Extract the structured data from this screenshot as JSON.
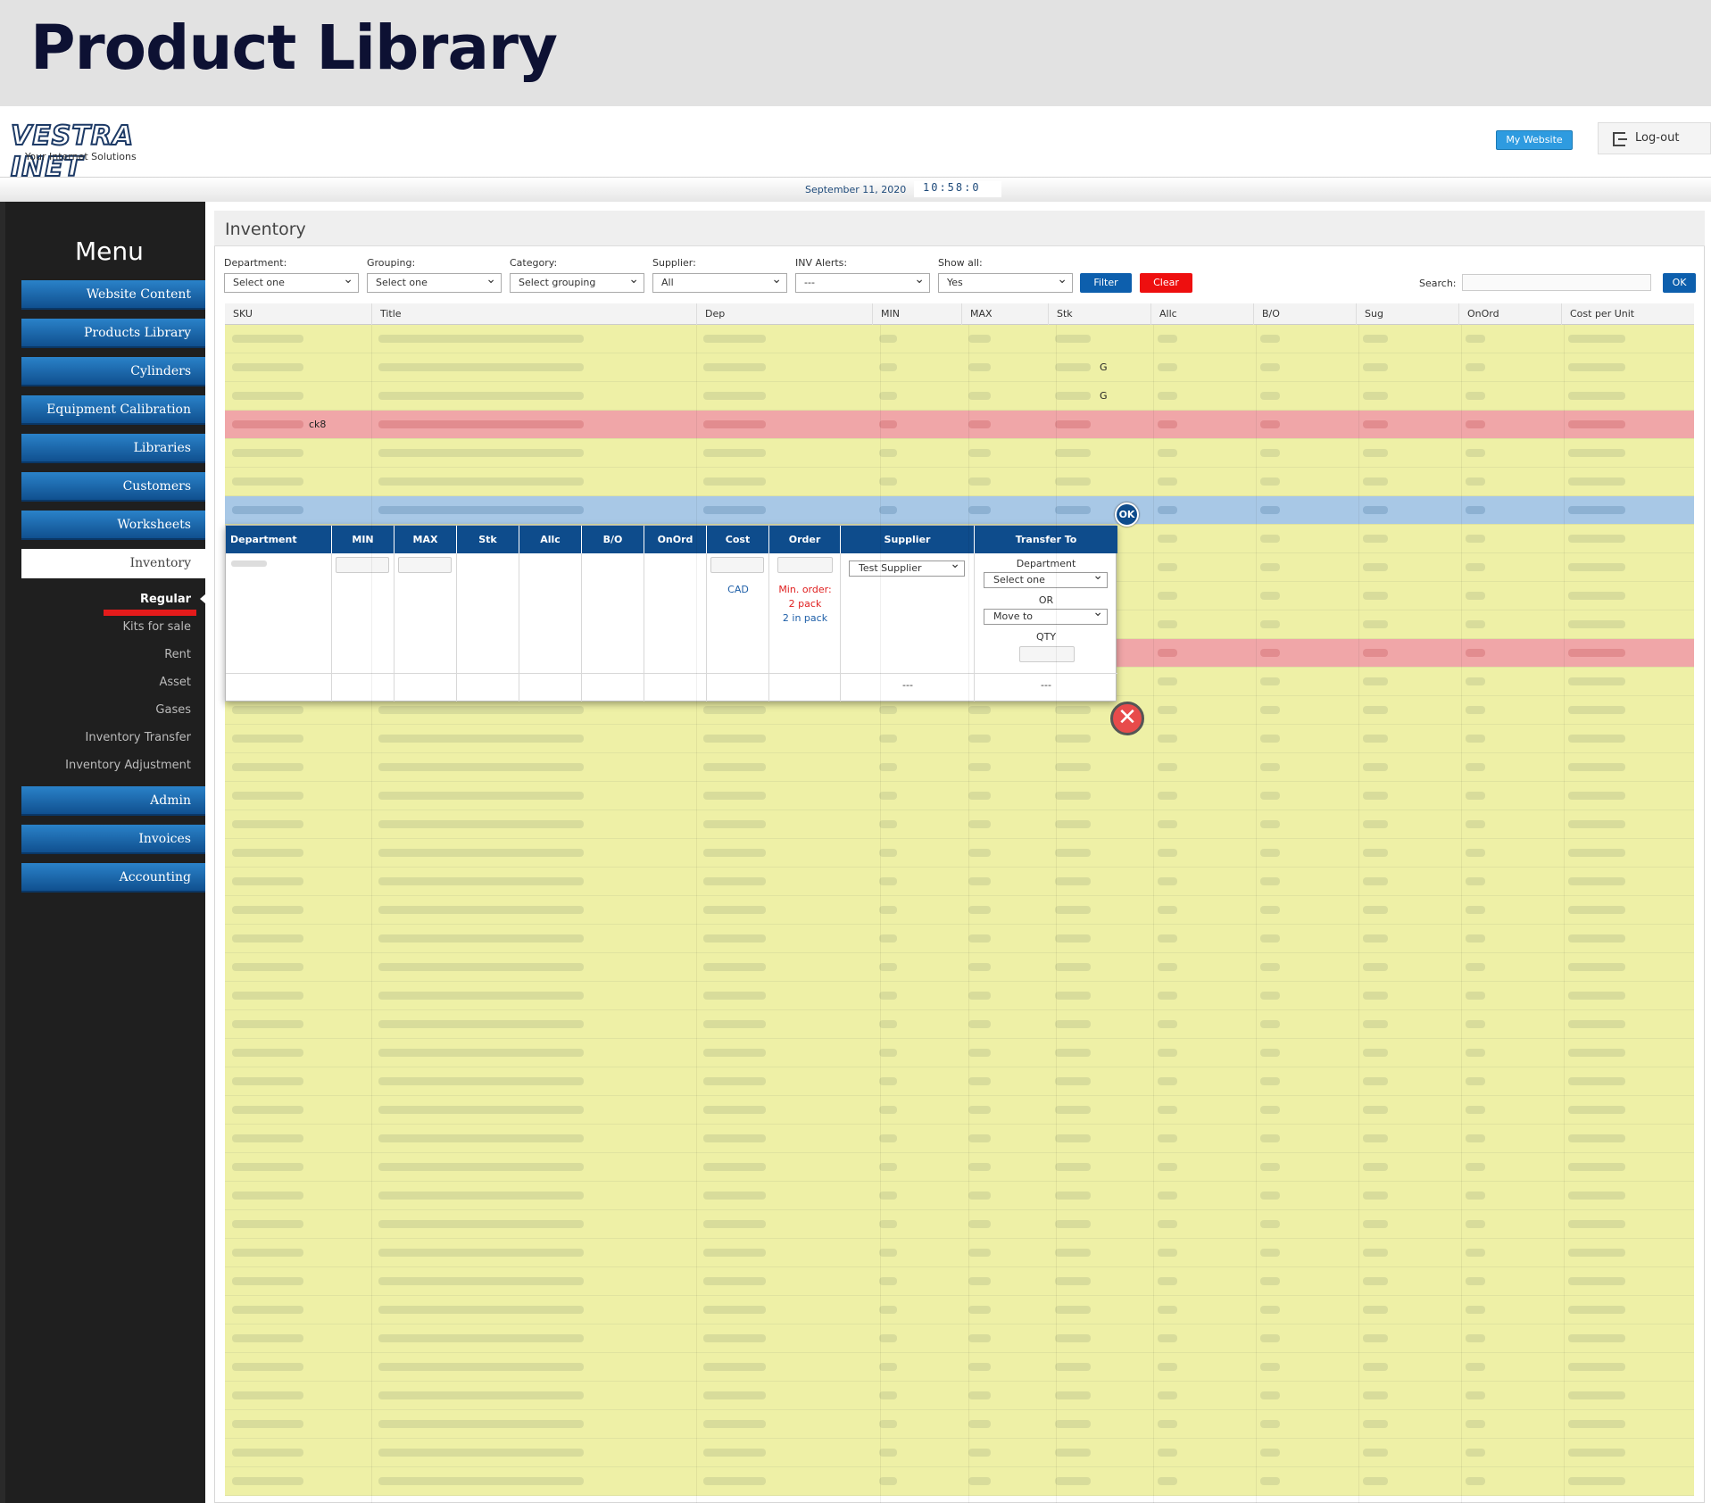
{
  "banner": {
    "title": "Product Library"
  },
  "header": {
    "logo_text": "VESTRA INET",
    "logo_tagline": "Your Internet Solutions",
    "my_website": "My Website",
    "logout": "Log-out",
    "date": "September 11, 2020",
    "clock": "10:58:0"
  },
  "sidebar": {
    "title": "Menu",
    "items": [
      {
        "label": "Website Content"
      },
      {
        "label": "Products Library"
      },
      {
        "label": "Cylinders"
      },
      {
        "label": "Equipment Calibration"
      },
      {
        "label": "Libraries"
      },
      {
        "label": "Customers"
      },
      {
        "label": "Worksheets"
      },
      {
        "label": "Inventory"
      }
    ],
    "subitems": [
      {
        "label": "Regular"
      },
      {
        "label": "Kits for sale"
      },
      {
        "label": "Rent"
      },
      {
        "label": "Asset"
      },
      {
        "label": "Gases"
      },
      {
        "label": "Inventory Transfer"
      },
      {
        "label": "Inventory Adjustment"
      }
    ],
    "bottom_items": [
      {
        "label": "Admin"
      },
      {
        "label": "Invoices"
      },
      {
        "label": "Accounting"
      }
    ]
  },
  "inventory": {
    "title": "Inventory",
    "filters": {
      "department": {
        "label": "Department:",
        "value": "Select one"
      },
      "grouping": {
        "label": "Grouping:",
        "value": "Select one"
      },
      "category": {
        "label": "Category:",
        "value": "Select grouping"
      },
      "supplier": {
        "label": "Supplier:",
        "value": "All"
      },
      "inv_alerts": {
        "label": "INV Alerts:",
        "value": "---"
      },
      "show_all": {
        "label": "Show all:",
        "value": "Yes"
      }
    },
    "filter_button": "Filter",
    "clear_button": "Clear",
    "search_label": "Search:",
    "search_value": "",
    "ok_button": "OK",
    "columns": [
      "SKU",
      "Title",
      "Dep",
      "MIN",
      "MAX",
      "Stk",
      "Allc",
      "B/O",
      "Sug",
      "OnOrd",
      "Cost per Unit"
    ],
    "visible_fragments": {
      "row3_stk": "G",
      "row2_stk": "G",
      "row4_sku": "ck8"
    },
    "row_states": [
      "green",
      "green",
      "green",
      "red",
      "green",
      "green",
      "blue",
      "green",
      "green",
      "green",
      "green",
      "red",
      "green",
      "green",
      "green",
      "green",
      "green",
      "green",
      "green",
      "green",
      "green",
      "green",
      "green",
      "green",
      "green",
      "green",
      "green",
      "green",
      "green",
      "green",
      "green",
      "green",
      "green",
      "green",
      "green",
      "green",
      "green",
      "green",
      "green",
      "green",
      "green"
    ]
  },
  "popup": {
    "ok_button": "OK",
    "columns": [
      "Department",
      "MIN",
      "MAX",
      "Stk",
      "Allc",
      "B/O",
      "OnOrd",
      "Cost",
      "Order",
      "Supplier",
      "Transfer To"
    ],
    "cost_currency": "CAD",
    "order_min_label": "Min. order:",
    "order_pack": "2 pack",
    "order_in_pack": "2 in pack",
    "supplier_value": "Test Supplier",
    "transfer": {
      "department_label": "Department",
      "department_value": "Select one",
      "or_label": "OR",
      "move_value": "Move to",
      "qty_label": "QTY"
    },
    "footer_supplier": "---",
    "footer_transfer": "---"
  },
  "colors": {
    "row_green": "#eef0a6",
    "row_red": "#f0a6a8",
    "row_blue": "#a8c8e6",
    "menu_blue": "#1a66ad",
    "popup_header": "#0e4c8c"
  }
}
